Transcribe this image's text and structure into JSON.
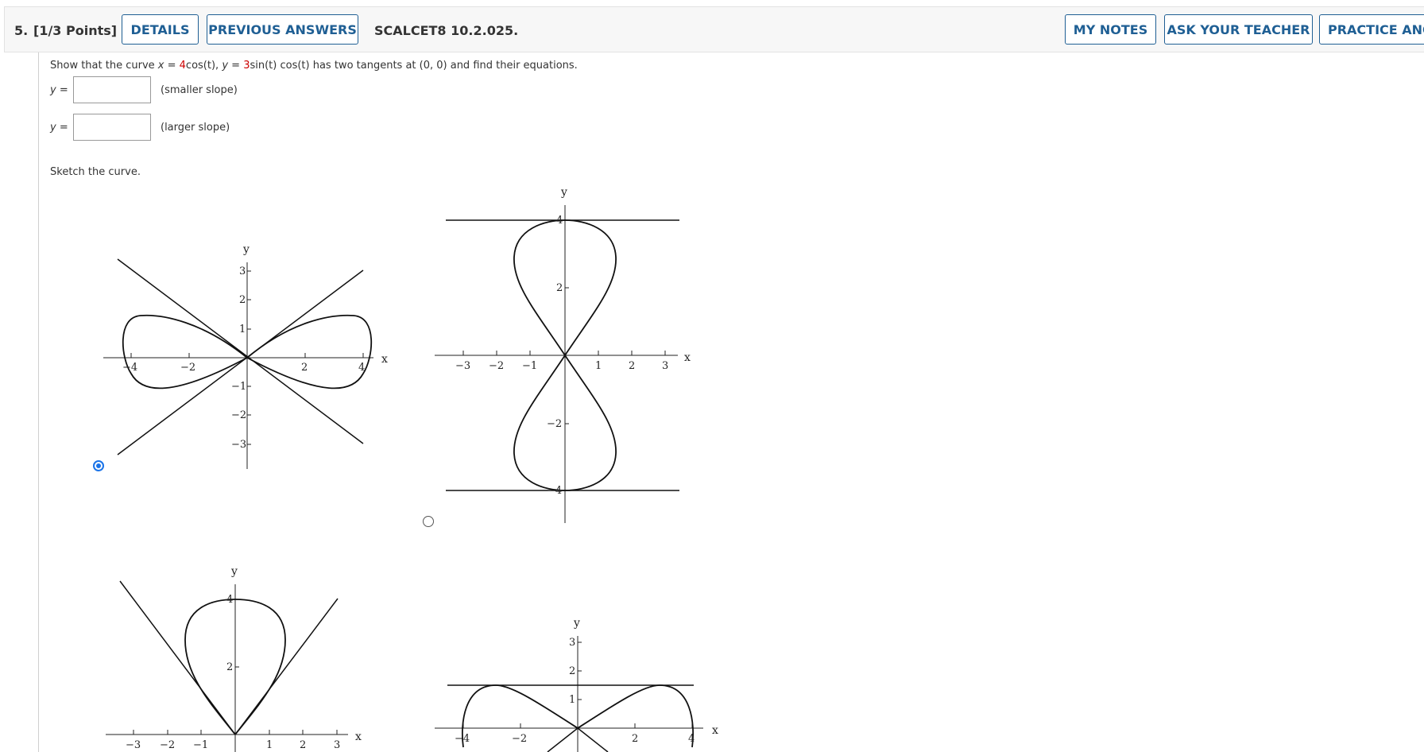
{
  "question": {
    "number": "5.",
    "points": "[1/3 Points]",
    "code": "SCALCET8 10.2.025."
  },
  "buttons": {
    "details": "DETAILS",
    "previous_answers": "PREVIOUS ANSWERS",
    "my_notes": "MY NOTES",
    "ask_teacher": "ASK YOUR TEACHER",
    "practice": "PRACTICE ANO"
  },
  "prompt": {
    "pre": "Show that the curve ",
    "x_label": "x",
    "eq": " = ",
    "x_coef": "4",
    "x_func": "cos(t), ",
    "y_label": "y",
    "y_coef": "3",
    "y_func": "sin(t) cos(t)",
    "post": "  has two tangents at (0, 0) and find their equations."
  },
  "answers": [
    {
      "label": "y =",
      "value": "",
      "hint": "(smaller slope)"
    },
    {
      "label": "y =",
      "value": "",
      "hint": "(larger slope)"
    }
  ],
  "sketch_prompt": "Sketch the curve.",
  "graphs": [
    {
      "selected": true,
      "x_axis": "x",
      "y_axis": "y",
      "x_ticks": [
        "−4",
        "−2",
        "2",
        "4"
      ],
      "y_ticks": [
        "3",
        "2",
        "1",
        "−1",
        "−2",
        "−3"
      ]
    },
    {
      "selected": false,
      "x_axis": "x",
      "y_axis": "y",
      "x_ticks": [
        "−3",
        "−2",
        "−1",
        "1",
        "2",
        "3"
      ],
      "y_ticks": [
        "4",
        "2",
        "−2",
        "−4"
      ]
    },
    {
      "selected": false,
      "x_axis": "x",
      "y_axis": "y",
      "x_ticks": [
        "−3",
        "−2",
        "−1",
        "1",
        "2",
        "3"
      ],
      "y_ticks": [
        "4",
        "2"
      ]
    },
    {
      "selected": false,
      "x_axis": "x",
      "y_axis": "y",
      "x_ticks": [
        "−4",
        "−2",
        "2",
        "4"
      ],
      "y_ticks": [
        "3",
        "2",
        "1"
      ]
    }
  ]
}
